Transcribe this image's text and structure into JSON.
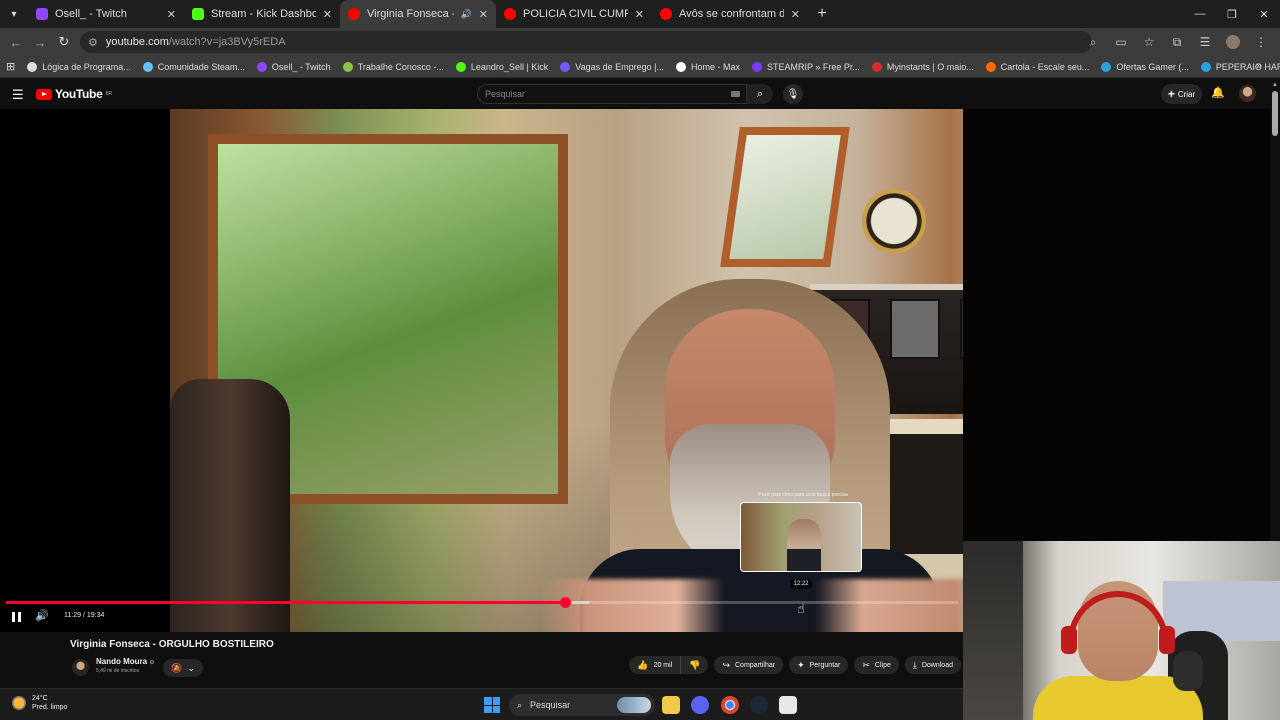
{
  "browser": {
    "tabs": [
      {
        "title": "Osell_ - Twitch",
        "favicon_color": "#9146ff",
        "active": false
      },
      {
        "title": "Stream - Kick Dashboard",
        "favicon_color": "#53fc18",
        "active": false
      },
      {
        "title": "Virginia Fonseca - ORGULHO",
        "favicon_color": "#ff0000",
        "active": true
      },
      {
        "title": "POLICIA CIVIL CUMPRE MANDA",
        "favicon_color": "#ff0000",
        "active": false
      },
      {
        "title": "Avôs se confrontam durante re",
        "favicon_color": "#ff0000",
        "active": false
      }
    ],
    "url": {
      "site": "youtube.com",
      "rest": "/watch?v=ja3BVy5rEDA"
    },
    "bookmarks": [
      {
        "label": "Lógica de Programa...",
        "color": "#dddddd"
      },
      {
        "label": "Comunidade Steam...",
        "color": "#66c0f4"
      },
      {
        "label": "Osell_ - Twitch",
        "color": "#9146ff"
      },
      {
        "label": "Trabalhe Conosco -...",
        "color": "#8bc34a"
      },
      {
        "label": "Leandro_Sell | Kick",
        "color": "#53fc18"
      },
      {
        "label": "Vagas de Emprego |...",
        "color": "#6d5dfc"
      },
      {
        "label": "Home - Max",
        "color": "#ffffff"
      },
      {
        "label": "STEAMRIP » Free Pr...",
        "color": "#7a3cff"
      },
      {
        "label": "Myinstants | O maio...",
        "color": "#d32f2f"
      },
      {
        "label": "Cartola - Escale seu...",
        "color": "#ff6d00"
      },
      {
        "label": "Ofertas Gamer (...",
        "color": "#2aa3e0"
      },
      {
        "label": "PEPERAIO HARDWA...",
        "color": "#2aa3e0"
      }
    ]
  },
  "youtube": {
    "logo_text": "YouTube",
    "logo_region": "BR",
    "search_placeholder": "Pesquisar",
    "create_label": "Criar",
    "video": {
      "title": "Virginia Fonseca - ORGULHO BOSTILEIRO",
      "current_time": "11:29 / 19:34",
      "played_fraction": 0.5869,
      "buffered_fraction": 0.612,
      "hover_fraction": 0.8385,
      "hover_time": "12:22",
      "hover_hint": "Puxe para cima para uma busca precisa"
    },
    "channel": {
      "name": "Nando Moura",
      "verified_mark": "⊙",
      "subscribers": "5,49 mi de inscritos"
    },
    "actions": {
      "likes": "20 mil",
      "share": "Compartilhar",
      "ask": "Perguntar",
      "clip": "Clipe",
      "download": "Download"
    }
  },
  "taskbar": {
    "weather_temp": "24°C",
    "weather_desc": "Pred. limpo",
    "search_label": "Pesquisar"
  }
}
